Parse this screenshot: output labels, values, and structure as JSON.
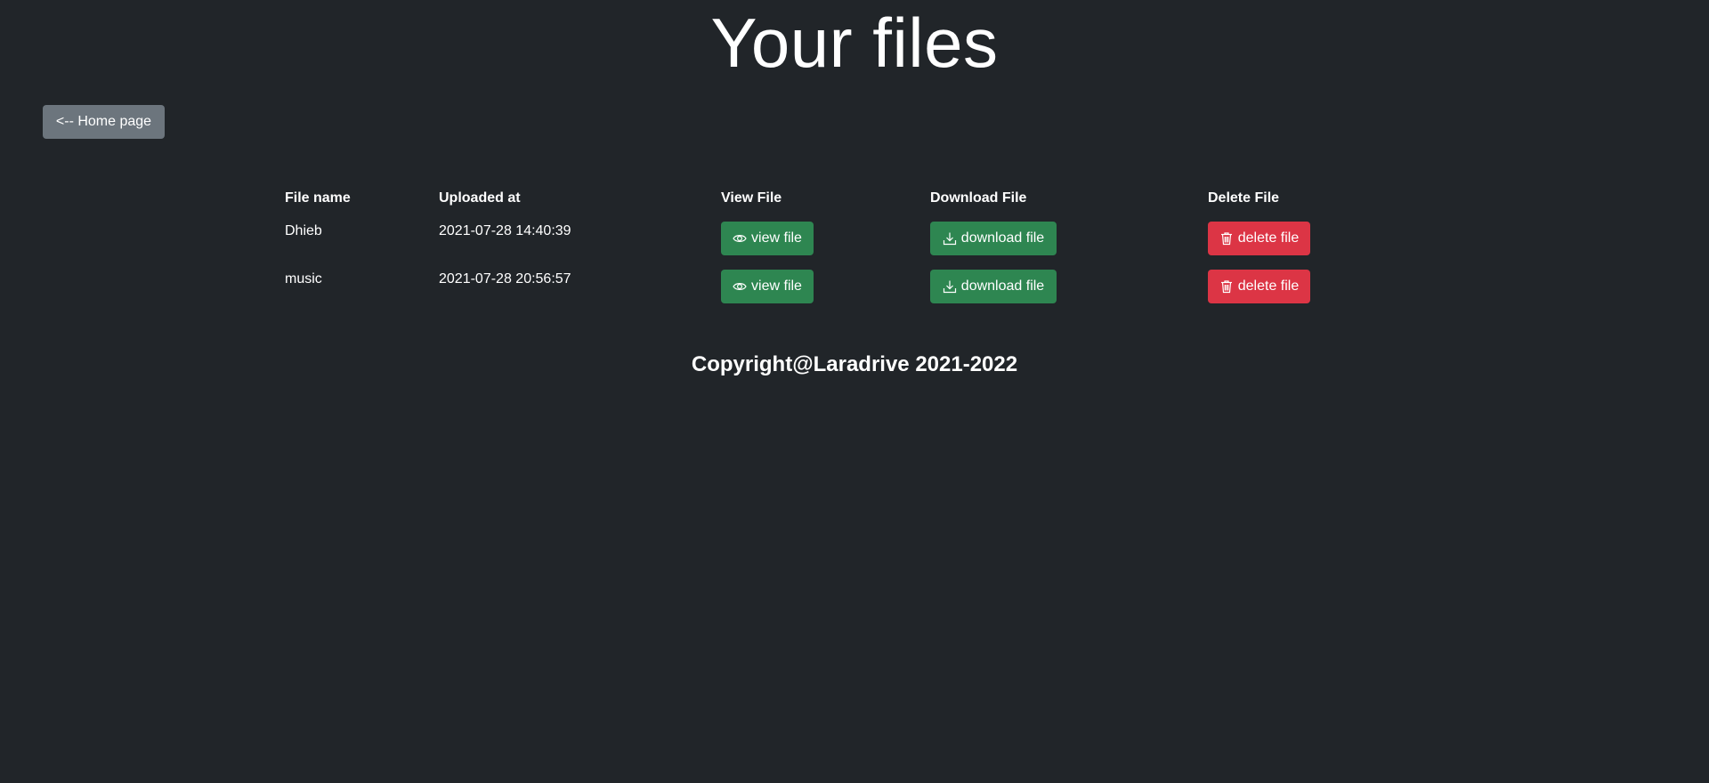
{
  "page": {
    "title": "Your files"
  },
  "nav": {
    "home_label": "<-- Home page"
  },
  "table": {
    "headers": {
      "file_name": "File name",
      "uploaded_at": "Uploaded at",
      "view": "View File",
      "download": "Download File",
      "delete": "Delete File"
    },
    "rows": [
      {
        "file_name": "Dhieb",
        "uploaded_at": "2021-07-28 14:40:39",
        "view_label": "view file",
        "download_label": "download file",
        "delete_label": "delete file"
      },
      {
        "file_name": "music",
        "uploaded_at": "2021-07-28 20:56:57",
        "view_label": "view file",
        "download_label": "download file",
        "delete_label": "delete file"
      }
    ]
  },
  "footer": {
    "text": "Copyright@Laradrive 2021-2022"
  },
  "colors": {
    "background": "#212529",
    "secondary": "#6c757d",
    "success": "#2e8651",
    "danger": "#dc3545"
  },
  "icons": {
    "view": "eye-icon",
    "download": "download-icon",
    "delete": "trash-icon"
  }
}
